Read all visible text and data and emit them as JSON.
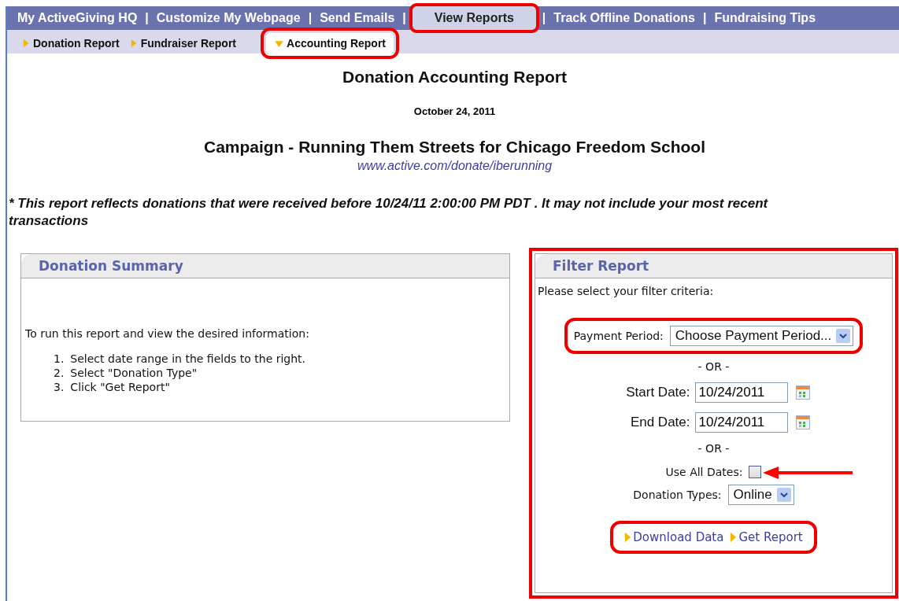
{
  "nav": {
    "items": [
      {
        "label": "My ActiveGiving HQ",
        "selected": false,
        "highlighted": false,
        "separator": "|"
      },
      {
        "label": "Customize My Webpage",
        "selected": false,
        "highlighted": false,
        "separator": "|"
      },
      {
        "label": "Send Emails",
        "selected": false,
        "highlighted": false,
        "separator": "|"
      },
      {
        "label": "View Reports",
        "selected": true,
        "highlighted": true,
        "separator": "|"
      },
      {
        "label": "Track Offline Donations",
        "selected": false,
        "highlighted": false,
        "separator": "|"
      },
      {
        "label": "Fundraising Tips",
        "selected": false,
        "highlighted": false
      }
    ]
  },
  "subnav": {
    "items": [
      {
        "label": "Donation Report",
        "selected": false,
        "highlighted": false
      },
      {
        "label": "Fundraiser Report",
        "selected": false,
        "highlighted": false
      },
      {
        "label": "Accounting Report",
        "selected": true,
        "highlighted": true
      }
    ]
  },
  "report": {
    "title": "Donation Accounting Report",
    "date": "October 24, 2011",
    "campaign": "Campaign - Running Them Streets for Chicago Freedom School",
    "url": "www.active.com/donate/iberunning",
    "notice": "* This report reflects donations that were received before 10/24/11 2:00:00 PM PDT . It may not include your most recent transactions"
  },
  "summary": {
    "title": "Donation Summary",
    "intro": "To run this report and view the desired information:",
    "steps": [
      {
        "number": "1.",
        "text": "Select date range in the fields to the right."
      },
      {
        "number": "2.",
        "text": "Select \"Donation Type\""
      },
      {
        "number": "3.",
        "text": "Click \"Get Report\""
      }
    ]
  },
  "filter": {
    "title": "Filter Report",
    "highlighted": true,
    "prompt": "Please select your filter criteria:",
    "payment_period": {
      "label": "Payment Period:",
      "value": "Choose Payment Period...",
      "highlighted": true
    },
    "or_1": "- OR -",
    "start_date": {
      "label": "Start Date:",
      "value": "10/24/2011"
    },
    "end_date": {
      "label": "End Date:",
      "value": "10/24/2011"
    },
    "or_2": "- OR -",
    "use_all_dates": {
      "label": "Use All Dates:",
      "checked": false,
      "arrow": true
    },
    "donation_types": {
      "label": "Donation Types:",
      "value": "Online"
    },
    "links": {
      "highlighted": true,
      "items": [
        {
          "label": "Download Data"
        },
        {
          "label": "Get Report"
        }
      ]
    }
  }
}
